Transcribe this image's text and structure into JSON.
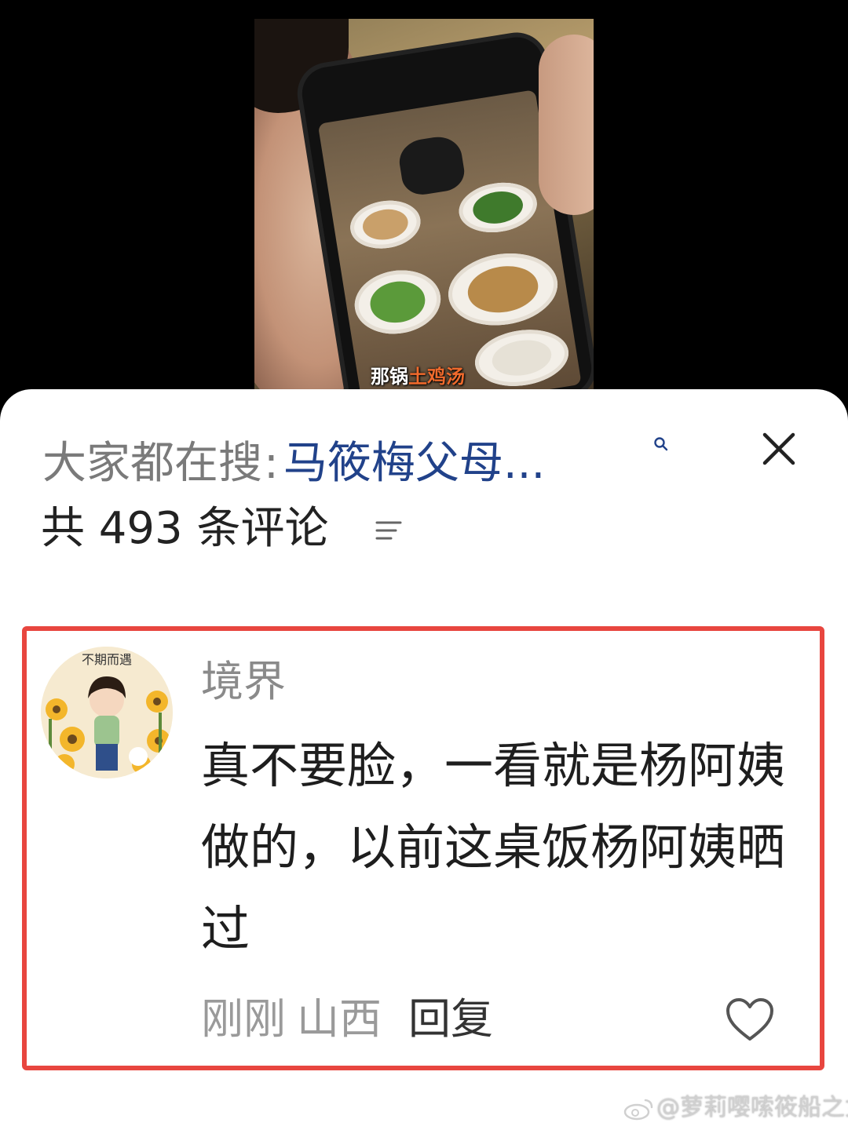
{
  "video": {
    "caption_part1": "那锅",
    "caption_part2": "土鸡汤"
  },
  "sheet": {
    "search_prefix": "大家都在搜",
    "search_colon": ":",
    "search_term": "马筱梅父母...",
    "comment_count_title": "共 493 条评论"
  },
  "comment": {
    "username": "境界",
    "text": "真不要脸，一看就是杨阿姨做的，以前这桌饭杨阿姨晒过",
    "time": "刚刚",
    "location": "山西",
    "reply_label": "回复",
    "avatar_caption": "不期而遇"
  },
  "watermark": {
    "text": "@萝莉嘤嗦筱船之女"
  },
  "colors": {
    "highlight_border": "#e8463f",
    "search_term": "#21428a",
    "caption_highlight": "#f06a2c"
  },
  "icons": [
    "search-icon",
    "close-icon",
    "sort-icon",
    "heart-icon",
    "weibo-logo-icon"
  ]
}
